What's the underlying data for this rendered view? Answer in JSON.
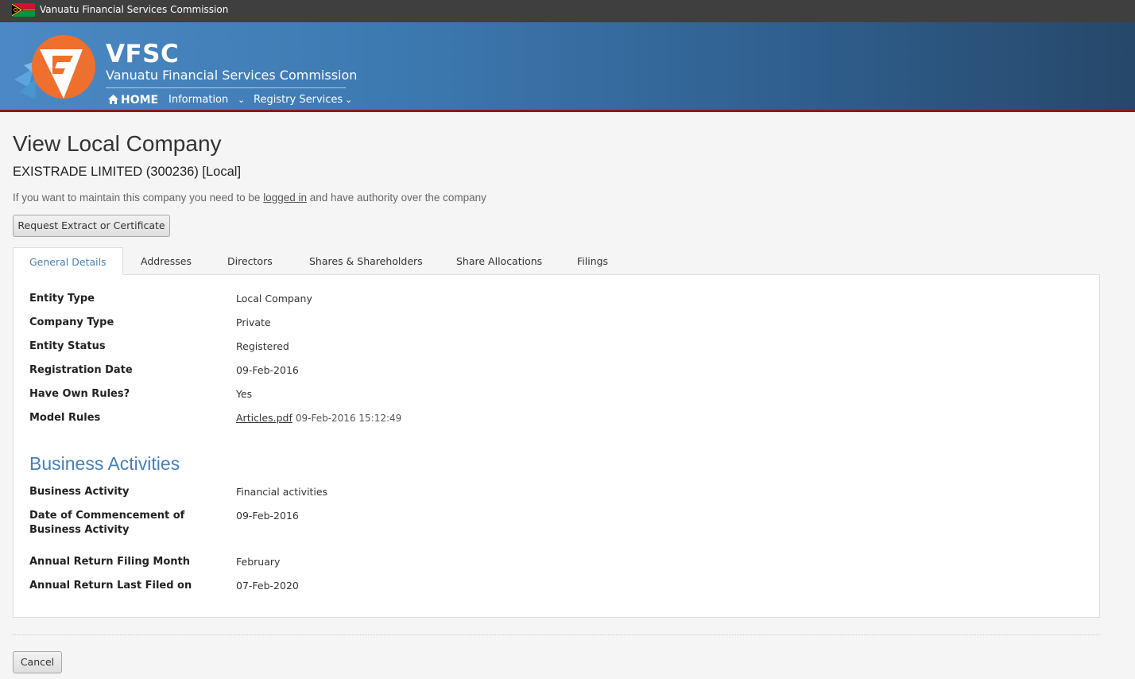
{
  "topbar": {
    "title": "Vanuatu Financial Services Commission"
  },
  "header": {
    "brand": "VFSC",
    "subtitle": "Vanuatu Financial Services Commission",
    "nav": [
      {
        "label": "HOME",
        "icon": "home-icon"
      },
      {
        "label": "Information",
        "icon": "chevron-down-icon"
      },
      {
        "label": "Registry Services",
        "icon": "chevron-down-icon"
      }
    ]
  },
  "page": {
    "title": "View Local Company",
    "company": "EXISTRADE LIMITED (300236) [Local]",
    "notice_before": "If you want to maintain this company you need to be ",
    "notice_link": "logged in",
    "notice_after": " and have authority over the company",
    "request_button": "Request Extract or Certificate",
    "cancel_button": "Cancel"
  },
  "tabs": [
    "General Details",
    "Addresses",
    "Directors",
    "Shares & Shareholders",
    "Share Allocations",
    "Filings"
  ],
  "general": [
    {
      "label": "Entity Type",
      "value": "Local Company"
    },
    {
      "label": "Company Type",
      "value": "Private"
    },
    {
      "label": "Entity Status",
      "value": "Registered"
    },
    {
      "label": "Registration Date",
      "value": "09-Feb-2016"
    },
    {
      "label": "Have Own Rules?",
      "value": "Yes"
    },
    {
      "label": "Model Rules",
      "link": "Articles.pdf",
      "timestamp": "09-Feb-2016 15:12:49"
    }
  ],
  "business": {
    "title": "Business Activities",
    "rows": [
      {
        "label": "Business Activity",
        "value": "Financial activities"
      },
      {
        "label": "Date of Commencement of Business Activity",
        "value": "09-Feb-2016"
      },
      {
        "label": "Annual Return Filing Month",
        "value": "February"
      },
      {
        "label": "Annual Return Last Filed on",
        "value": "07-Feb-2020"
      }
    ]
  },
  "colors": {
    "accent": "#4a7fb5",
    "header_dark": "#26486a",
    "header_light": "#4c89c4",
    "header_border": "#8b1a1a"
  }
}
